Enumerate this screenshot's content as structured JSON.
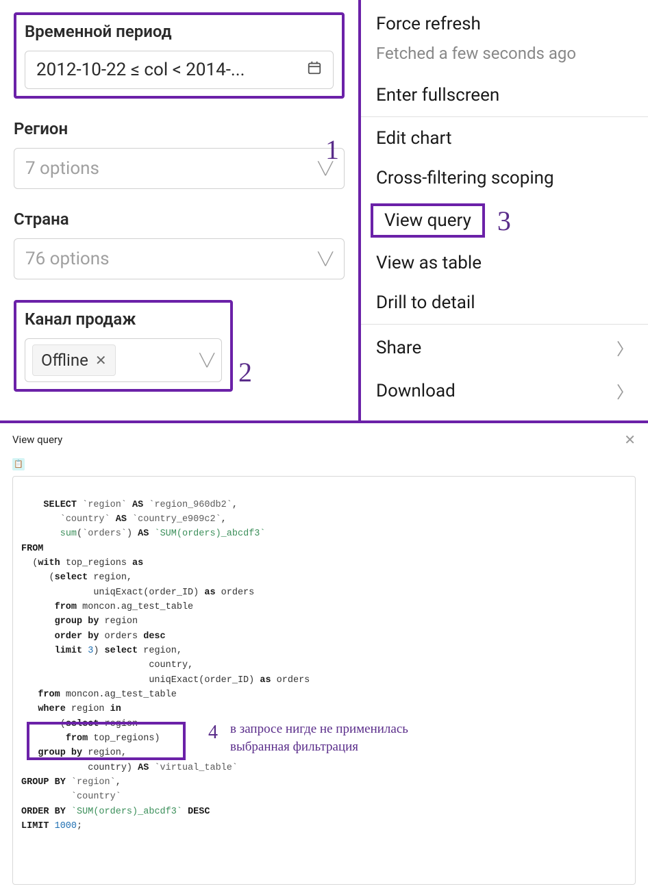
{
  "filters": {
    "time": {
      "label": "Временной период",
      "value": "2012-10-22 ≤ col < 2014-..."
    },
    "region": {
      "label": "Регион",
      "placeholder": "7 options"
    },
    "country": {
      "label": "Страна",
      "placeholder": "76 options"
    },
    "channel": {
      "label": "Канал продаж",
      "tag": "Offline"
    }
  },
  "annotations": {
    "num1": "1",
    "num2": "2",
    "num3": "3",
    "num4": "4",
    "text4_line1": "в запросе нигде не применилась",
    "text4_line2": "выбранная фильтрация"
  },
  "menu": {
    "force_refresh": "Force refresh",
    "fetched": "Fetched a few seconds ago",
    "fullscreen": "Enter fullscreen",
    "edit_chart": "Edit chart",
    "cross_filter": "Cross-filtering scoping",
    "view_query": "View query",
    "view_table": "View as table",
    "drill": "Drill to detail",
    "share": "Share",
    "download": "Download"
  },
  "query": {
    "title": "View query",
    "sql_lines": [
      {
        "indent": 0,
        "segments": [
          {
            "t": "SELECT ",
            "c": "kw"
          },
          {
            "t": "`region`",
            "c": "bt"
          },
          {
            "t": " AS ",
            "c": "kw"
          },
          {
            "t": "`region_960db2`",
            "c": "bt"
          },
          {
            "t": ",",
            "c": ""
          }
        ]
      },
      {
        "indent": 7,
        "segments": [
          {
            "t": "`country`",
            "c": "bt"
          },
          {
            "t": " AS ",
            "c": "kw"
          },
          {
            "t": "`country_e909c2`",
            "c": "bt"
          },
          {
            "t": ",",
            "c": ""
          }
        ]
      },
      {
        "indent": 7,
        "segments": [
          {
            "t": "sum",
            "c": "fn"
          },
          {
            "t": "(",
            "c": ""
          },
          {
            "t": "`orders`",
            "c": "bt"
          },
          {
            "t": ")",
            "c": ""
          },
          {
            "t": " AS ",
            "c": "kw"
          },
          {
            "t": "`SUM(orders)_abcdf3`",
            "c": "fn"
          }
        ]
      },
      {
        "indent": 0,
        "segments": [
          {
            "t": "FROM",
            "c": "kw"
          }
        ]
      },
      {
        "indent": 2,
        "segments": [
          {
            "t": "(",
            "c": ""
          },
          {
            "t": "with",
            "c": "kw"
          },
          {
            "t": " top_regions ",
            "c": ""
          },
          {
            "t": "as",
            "c": "kw"
          }
        ]
      },
      {
        "indent": 5,
        "segments": [
          {
            "t": "(",
            "c": ""
          },
          {
            "t": "select",
            "c": "kw"
          },
          {
            "t": " region,",
            "c": ""
          }
        ]
      },
      {
        "indent": 13,
        "segments": [
          {
            "t": "uniqExact(order_ID) ",
            "c": ""
          },
          {
            "t": "as",
            "c": "kw"
          },
          {
            "t": " orders",
            "c": ""
          }
        ]
      },
      {
        "indent": 6,
        "segments": [
          {
            "t": "from",
            "c": "kw"
          },
          {
            "t": " moncon.ag_test_table",
            "c": ""
          }
        ]
      },
      {
        "indent": 6,
        "segments": [
          {
            "t": "group by",
            "c": "kw"
          },
          {
            "t": " region",
            "c": ""
          }
        ]
      },
      {
        "indent": 6,
        "segments": [
          {
            "t": "order by",
            "c": "kw"
          },
          {
            "t": " orders ",
            "c": ""
          },
          {
            "t": "desc",
            "c": "kw"
          }
        ]
      },
      {
        "indent": 6,
        "segments": [
          {
            "t": "limit ",
            "c": "kw"
          },
          {
            "t": "3",
            "c": "num"
          },
          {
            "t": ") ",
            "c": ""
          },
          {
            "t": "select",
            "c": "kw"
          },
          {
            "t": " region,",
            "c": ""
          }
        ]
      },
      {
        "indent": 23,
        "segments": [
          {
            "t": "country,",
            "c": ""
          }
        ]
      },
      {
        "indent": 23,
        "segments": [
          {
            "t": "uniqExact(order_ID) ",
            "c": ""
          },
          {
            "t": "as",
            "c": "kw"
          },
          {
            "t": " orders",
            "c": ""
          }
        ]
      },
      {
        "indent": 3,
        "segments": [
          {
            "t": "from",
            "c": "kw"
          },
          {
            "t": " moncon.ag_test_table",
            "c": ""
          }
        ]
      },
      {
        "indent": 3,
        "segments": [
          {
            "t": "where",
            "c": "kw"
          },
          {
            "t": " region ",
            "c": ""
          },
          {
            "t": "in",
            "c": "kw"
          }
        ]
      },
      {
        "indent": 7,
        "segments": [
          {
            "t": "(",
            "c": ""
          },
          {
            "t": "select",
            "c": "kw"
          },
          {
            "t": " region",
            "c": ""
          }
        ]
      },
      {
        "indent": 8,
        "segments": [
          {
            "t": "from",
            "c": "kw"
          },
          {
            "t": " top_regions)",
            "c": ""
          }
        ]
      },
      {
        "indent": 3,
        "segments": [
          {
            "t": "group by",
            "c": "kw"
          },
          {
            "t": " region,",
            "c": ""
          }
        ]
      },
      {
        "indent": 12,
        "segments": [
          {
            "t": "country) ",
            "c": ""
          },
          {
            "t": "AS",
            "c": "kw"
          },
          {
            "t": " ",
            "c": ""
          },
          {
            "t": "`virtual_table`",
            "c": "bt"
          }
        ]
      },
      {
        "indent": 0,
        "segments": [
          {
            "t": "GROUP BY",
            "c": "kw"
          },
          {
            "t": " ",
            "c": ""
          },
          {
            "t": "`region`",
            "c": "bt"
          },
          {
            "t": ",",
            "c": ""
          }
        ]
      },
      {
        "indent": 9,
        "segments": [
          {
            "t": "`country`",
            "c": "bt"
          }
        ]
      },
      {
        "indent": 0,
        "segments": [
          {
            "t": "ORDER BY",
            "c": "kw"
          },
          {
            "t": " ",
            "c": ""
          },
          {
            "t": "`SUM(orders)_abcdf3`",
            "c": "fn"
          },
          {
            "t": " ",
            "c": ""
          },
          {
            "t": "DESC",
            "c": "kw"
          }
        ]
      },
      {
        "indent": 0,
        "segments": [
          {
            "t": "LIMIT ",
            "c": "kw"
          },
          {
            "t": "1000",
            "c": "num"
          },
          {
            "t": ";",
            "c": ""
          }
        ]
      }
    ]
  }
}
